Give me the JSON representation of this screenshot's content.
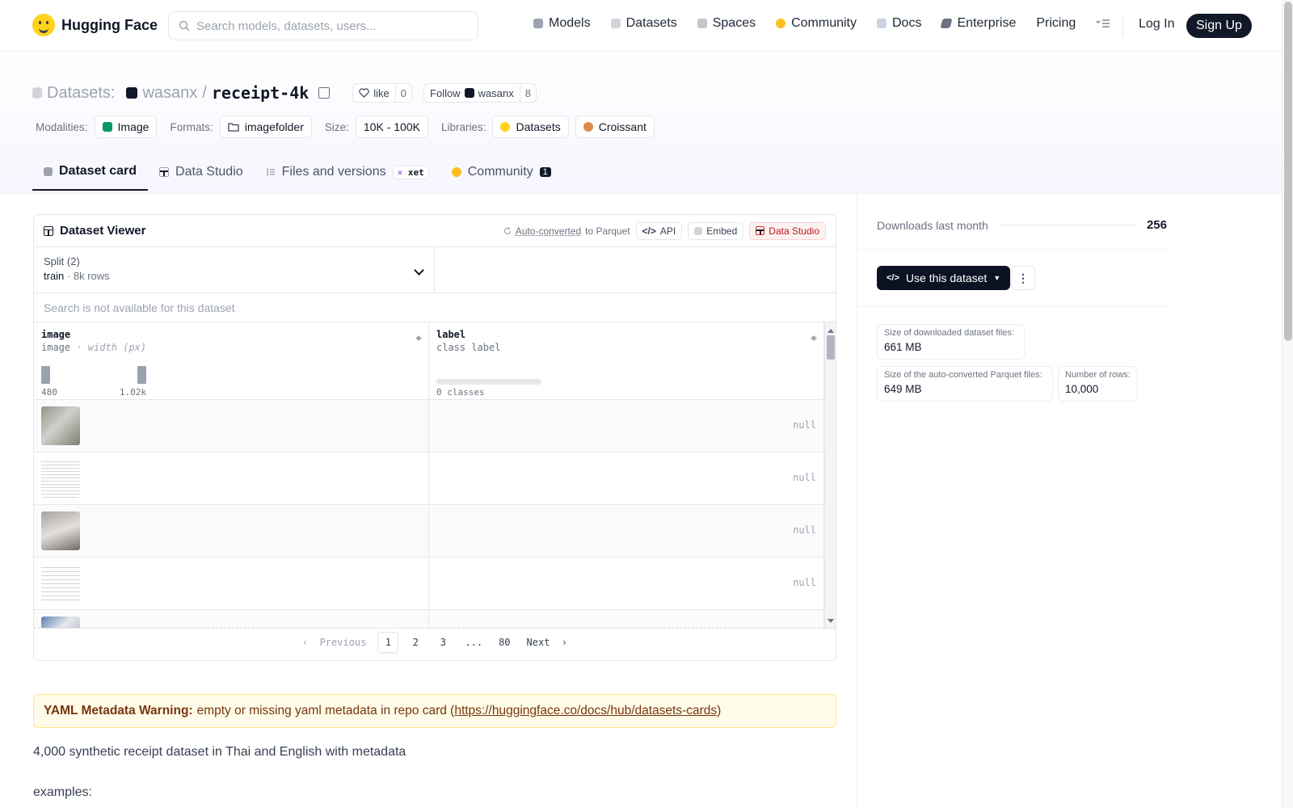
{
  "header": {
    "brand": "Hugging Face",
    "search_placeholder": "Search models, datasets, users...",
    "nav": [
      {
        "label": "Models",
        "icon": "models-icon",
        "color": "#9ca3af"
      },
      {
        "label": "Datasets",
        "icon": "datasets-icon",
        "color": "#d1d5db"
      },
      {
        "label": "Spaces",
        "icon": "spaces-icon",
        "color": "#9ca3af"
      },
      {
        "label": "Community",
        "icon": "community-icon",
        "color": "#fbbf24"
      },
      {
        "label": "Docs",
        "icon": "docs-icon",
        "color": "#9ca3af"
      },
      {
        "label": "Enterprise",
        "icon": "enterprise-icon",
        "color": "#6b7280"
      },
      {
        "label": "Pricing"
      }
    ],
    "login": "Log In",
    "signup": "Sign Up"
  },
  "repo": {
    "section": "Datasets:",
    "owner": "wasanx",
    "slash": "/",
    "name": "receipt-4k",
    "like_label": "like",
    "like_count": "0",
    "follow_label": "Follow",
    "follow_user": "wasanx",
    "follow_count": "8",
    "meta": {
      "modalities_label": "Modalities:",
      "modality": "Image",
      "formats_label": "Formats:",
      "format": "imagefolder",
      "size_label": "Size:",
      "size": "10K - 100K",
      "libraries_label": "Libraries:",
      "libraries": [
        "Datasets",
        "Croissant"
      ]
    },
    "tabs": [
      {
        "label": "Dataset card",
        "active": true
      },
      {
        "label": "Data Studio"
      },
      {
        "label": "Files and versions",
        "badge": "xet"
      },
      {
        "label": "Community",
        "badge": "1"
      }
    ]
  },
  "viewer": {
    "title": "Dataset Viewer",
    "auto_converted": "Auto-converted",
    "to_parquet": "to Parquet",
    "api": "API",
    "embed": "Embed",
    "data_studio": "Data Studio",
    "split_label": "Split (2)",
    "split_value": "train",
    "split_sep": "·",
    "split_rows": "8k rows",
    "search_na": "Search is not available for this dataset",
    "columns": [
      {
        "name": "image",
        "type": "image",
        "type_extra": "· width (px)",
        "hist_min": "480",
        "hist_max": "1.02k",
        "hist_values": [
          0.85,
          0.85
        ]
      },
      {
        "name": "label",
        "type": "class label",
        "summary": "0 classes"
      }
    ],
    "rows": [
      {
        "image": "receipt-photo-1",
        "label": "null"
      },
      {
        "image": "receipt-scan-2",
        "label": "null"
      },
      {
        "image": "receipt-photo-3",
        "label": "null"
      },
      {
        "image": "receipt-scan-4",
        "label": "null"
      },
      {
        "image": "receipt-photo-5",
        "label": ""
      }
    ],
    "pager": {
      "prev": "Previous",
      "pages": [
        "1",
        "2",
        "3",
        "...",
        "80"
      ],
      "current": "1",
      "next": "Next"
    }
  },
  "warning": {
    "bold": "YAML Metadata Warning:",
    "text": "empty or missing yaml metadata in repo card (",
    "link": "https://huggingface.co/docs/hub/datasets-cards",
    "close": ")"
  },
  "body": {
    "description": "4,000 synthetic receipt dataset in Thai and English with metadata",
    "examples": "examples:"
  },
  "sidebar": {
    "downloads_label": "Downloads last month",
    "downloads": "256",
    "use_dataset": "Use this dataset",
    "stats": [
      {
        "label": "Size of downloaded dataset files:",
        "value": "661 MB"
      },
      {
        "label": "Size of the auto-converted Parquet files:",
        "value": "649 MB"
      },
      {
        "label": "Number of rows:",
        "value": "10,000"
      }
    ]
  },
  "colors": {
    "accent_dark": "#111827",
    "warning_bg": "#fefce8",
    "studio_red": "#b91c1c",
    "brand_yellow": "#ffd21e"
  }
}
